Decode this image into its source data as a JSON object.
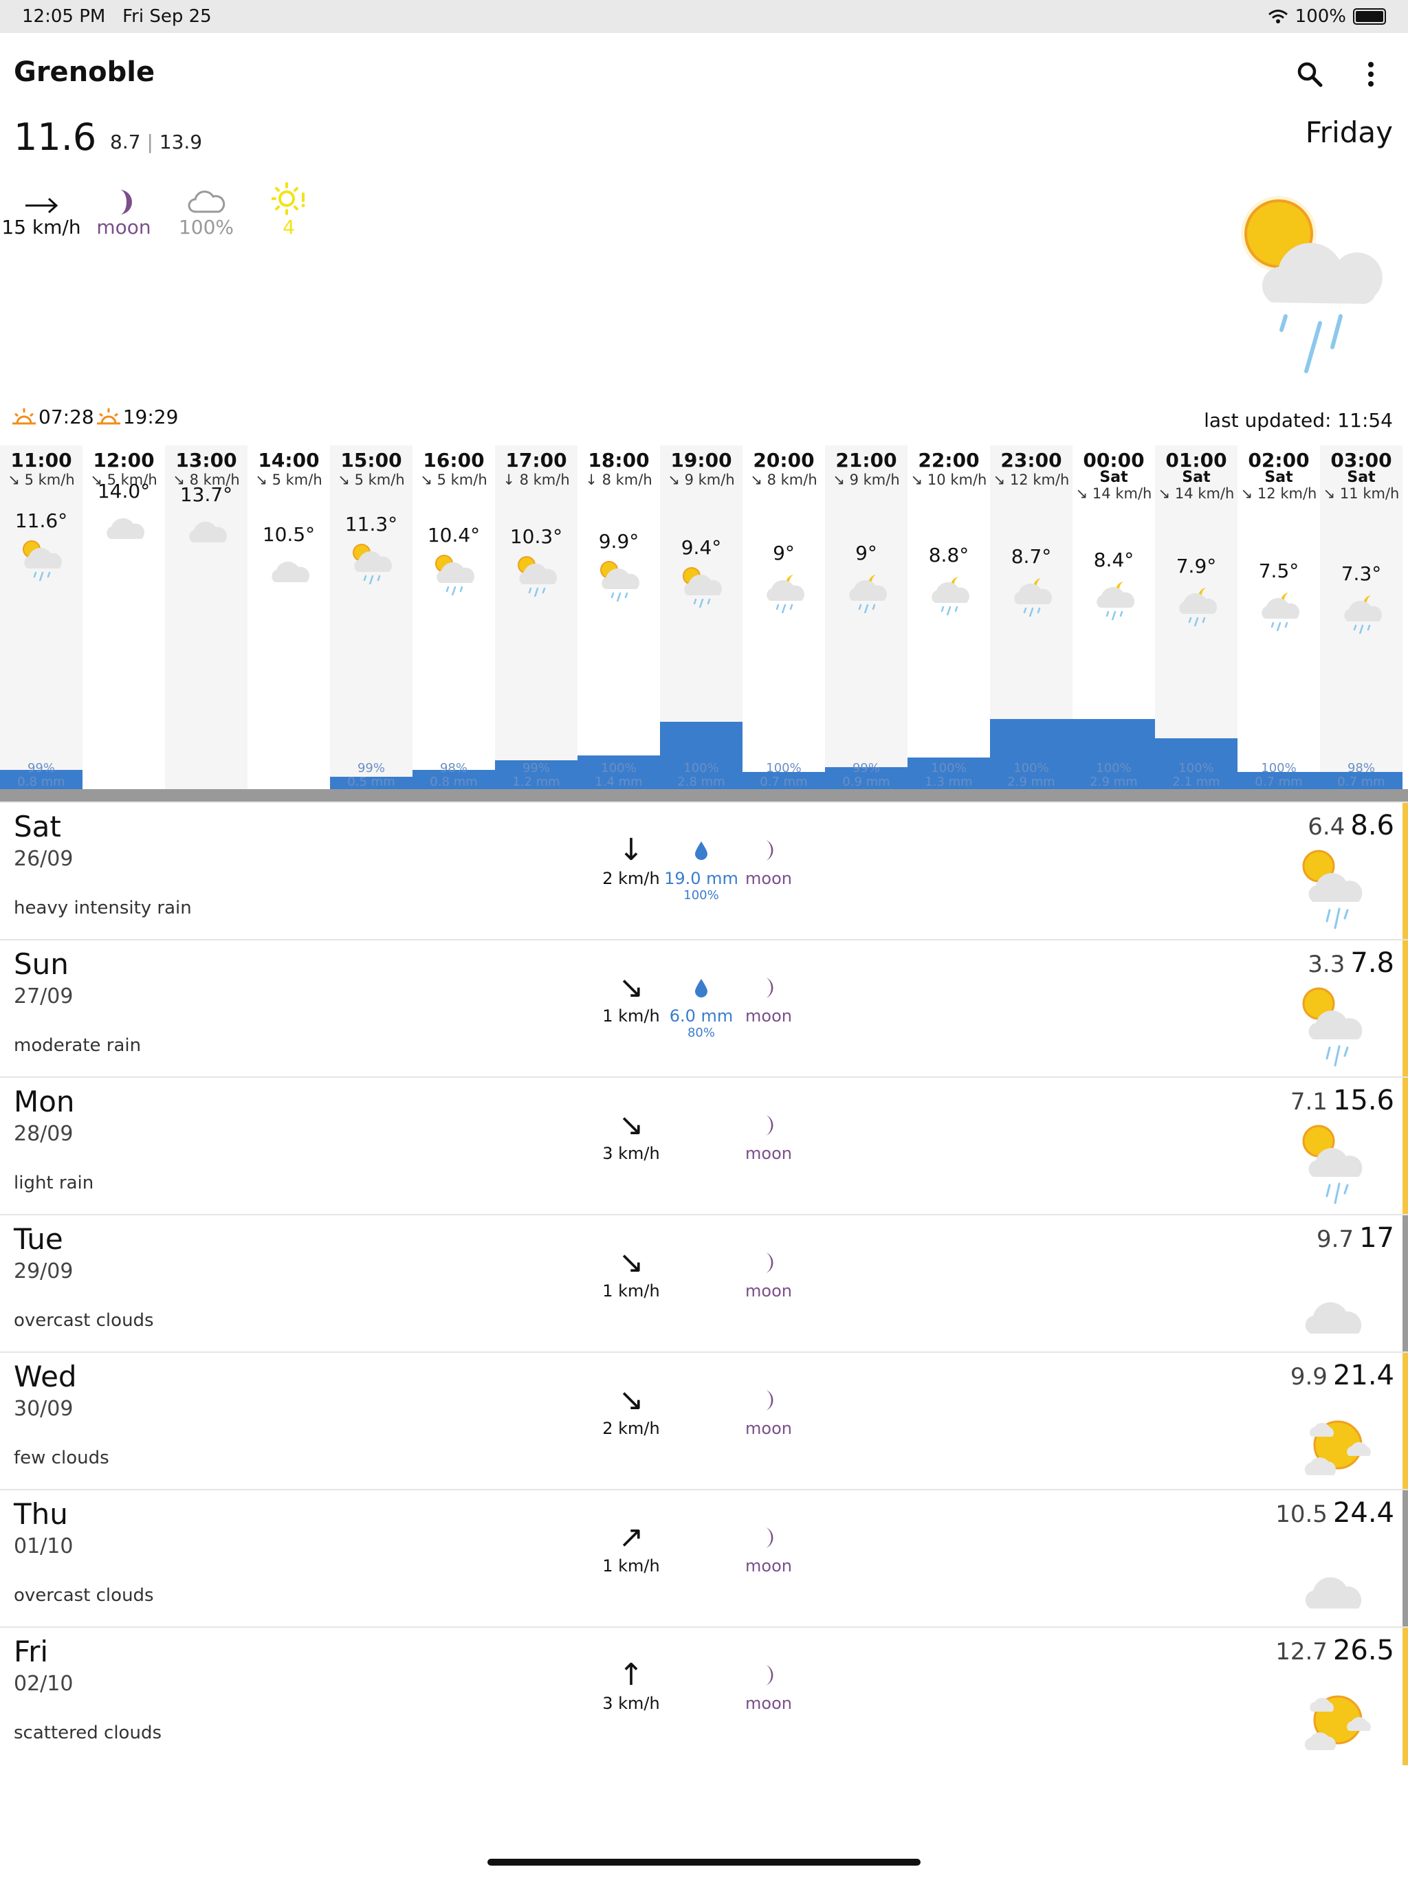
{
  "status_bar": {
    "time": "12:05 PM",
    "date": "Fri Sep 25",
    "battery": "100%"
  },
  "header": {
    "city": "Grenoble",
    "temp": "11.6",
    "min": "8.7",
    "separator": "|",
    "max": "13.9",
    "day": "Friday"
  },
  "indicators": {
    "wind": "15 km/h",
    "moon": "moon",
    "cloud": "100%",
    "uv": "4"
  },
  "sun": {
    "sunrise": "07:28",
    "sunset": "19:29"
  },
  "last_updated": "last updated: 11:54",
  "colors": {
    "rain_bar": "#3a7dcc",
    "moon": "#7b4f8a",
    "sun": "#f5c518",
    "uv": "#f2e318"
  },
  "hourly": [
    {
      "time": "11:00",
      "day": "",
      "wind": "↘ 5 km/h",
      "temp": "11.6°",
      "icon": "sun-cloud-rain-icon",
      "prob": "99%",
      "mm": "0.8 mm",
      "precip": 0.8
    },
    {
      "time": "12:00",
      "day": "",
      "wind": "↘ 5 km/h",
      "temp": "14.0°",
      "icon": "cloud-icon",
      "prob": "",
      "mm": "",
      "precip": 0
    },
    {
      "time": "13:00",
      "day": "",
      "wind": "↘ 8 km/h",
      "temp": "13.7°",
      "icon": "cloud-icon",
      "prob": "",
      "mm": "",
      "precip": 0
    },
    {
      "time": "14:00",
      "day": "",
      "wind": "↘ 5 km/h",
      "temp": "10.5°",
      "icon": "cloud-icon",
      "prob": "",
      "mm": "",
      "precip": 0
    },
    {
      "time": "15:00",
      "day": "",
      "wind": "↘ 5 km/h",
      "temp": "11.3°",
      "icon": "sun-cloud-rain-icon",
      "prob": "99%",
      "mm": "0.5 mm",
      "precip": 0.5
    },
    {
      "time": "16:00",
      "day": "",
      "wind": "↘ 5 km/h",
      "temp": "10.4°",
      "icon": "sun-cloud-rain-icon",
      "prob": "98%",
      "mm": "0.8 mm",
      "precip": 0.8
    },
    {
      "time": "17:00",
      "day": "",
      "wind": "↓ 8 km/h",
      "temp": "10.3°",
      "icon": "sun-cloud-rain-icon",
      "prob": "99%",
      "mm": "1.2 mm",
      "precip": 1.2
    },
    {
      "time": "18:00",
      "day": "",
      "wind": "↓ 8 km/h",
      "temp": "9.9°",
      "icon": "sun-cloud-rain-icon",
      "prob": "100%",
      "mm": "1.4 mm",
      "precip": 1.4
    },
    {
      "time": "19:00",
      "day": "",
      "wind": "↘ 9 km/h",
      "temp": "9.4°",
      "icon": "sun-cloud-rain-icon",
      "prob": "100%",
      "mm": "2.8 mm",
      "precip": 2.8
    },
    {
      "time": "20:00",
      "day": "",
      "wind": "↘ 8 km/h",
      "temp": "9°",
      "icon": "moon-cloud-rain-icon",
      "prob": "100%",
      "mm": "0.7 mm",
      "precip": 0.7
    },
    {
      "time": "21:00",
      "day": "",
      "wind": "↘ 9 km/h",
      "temp": "9°",
      "icon": "moon-cloud-rain-icon",
      "prob": "99%",
      "mm": "0.9 mm",
      "precip": 0.9
    },
    {
      "time": "22:00",
      "day": "",
      "wind": "↘ 10 km/h",
      "temp": "8.8°",
      "icon": "moon-cloud-rain-icon",
      "prob": "100%",
      "mm": "1.3 mm",
      "precip": 1.3
    },
    {
      "time": "23:00",
      "day": "",
      "wind": "↘ 12 km/h",
      "temp": "8.7°",
      "icon": "moon-cloud-rain-icon",
      "prob": "100%",
      "mm": "2.9 mm",
      "precip": 2.9
    },
    {
      "time": "00:00",
      "day": "Sat",
      "wind": "↘ 14 km/h",
      "temp": "8.4°",
      "icon": "moon-cloud-rain-icon",
      "prob": "100%",
      "mm": "2.9 mm",
      "precip": 2.9
    },
    {
      "time": "01:00",
      "day": "Sat",
      "wind": "↘ 14 km/h",
      "temp": "7.9°",
      "icon": "moon-cloud-rain-icon",
      "prob": "100%",
      "mm": "2.1 mm",
      "precip": 2.1
    },
    {
      "time": "02:00",
      "day": "Sat",
      "wind": "↘ 12 km/h",
      "temp": "7.5°",
      "icon": "moon-cloud-rain-icon",
      "prob": "100%",
      "mm": "0.7 mm",
      "precip": 0.7
    },
    {
      "time": "03:00",
      "day": "Sat",
      "wind": "↘ 11 km/h",
      "temp": "7.3°",
      "icon": "moon-cloud-rain-icon",
      "prob": "98%",
      "mm": "0.7 mm",
      "precip": 0.7
    }
  ],
  "daily": [
    {
      "name": "Sat",
      "date": "26/09",
      "desc": "heavy intensity rain",
      "wind_arrow": "↓",
      "wind": "2 km/h",
      "rain_mm": "19.0 mm",
      "rain_pct": "100%",
      "moon": "moon",
      "min": "6.4",
      "max": "8.6",
      "icon": "sun-cloud-rain-icon",
      "stripe": "#f5c542"
    },
    {
      "name": "Sun",
      "date": "27/09",
      "desc": "moderate rain",
      "wind_arrow": "↘",
      "wind": "1 km/h",
      "rain_mm": "6.0 mm",
      "rain_pct": "80%",
      "moon": "moon",
      "min": "3.3",
      "max": "7.8",
      "icon": "sun-cloud-rain-icon",
      "stripe": "#f5c542"
    },
    {
      "name": "Mon",
      "date": "28/09",
      "desc": "light rain",
      "wind_arrow": "↘",
      "wind": "3 km/h",
      "rain_mm": "",
      "rain_pct": "",
      "moon": "moon",
      "min": "7.1",
      "max": "15.6",
      "icon": "sun-cloud-rain-icon",
      "stripe": "#f5c542"
    },
    {
      "name": "Tue",
      "date": "29/09",
      "desc": "overcast clouds",
      "wind_arrow": "↘",
      "wind": "1 km/h",
      "rain_mm": "",
      "rain_pct": "",
      "moon": "moon",
      "min": "9.7",
      "max": "17",
      "icon": "cloud-icon",
      "stripe": "#9a9a9a"
    },
    {
      "name": "Wed",
      "date": "30/09",
      "desc": "few clouds",
      "wind_arrow": "↘",
      "wind": "2 km/h",
      "rain_mm": "",
      "rain_pct": "",
      "moon": "moon",
      "min": "9.9",
      "max": "21.4",
      "icon": "sun-few-clouds-icon",
      "stripe": "#f5c542"
    },
    {
      "name": "Thu",
      "date": "01/10",
      "desc": "overcast clouds",
      "wind_arrow": "↗",
      "wind": "1 km/h",
      "rain_mm": "",
      "rain_pct": "",
      "moon": "moon",
      "min": "10.5",
      "max": "24.4",
      "icon": "cloud-icon",
      "stripe": "#9a9a9a"
    },
    {
      "name": "Fri",
      "date": "02/10",
      "desc": "scattered clouds",
      "wind_arrow": "↑",
      "wind": "3 km/h",
      "rain_mm": "",
      "rain_pct": "",
      "moon": "moon",
      "min": "12.7",
      "max": "26.5",
      "icon": "sun-few-clouds-icon",
      "stripe": "#f5c542"
    }
  ]
}
